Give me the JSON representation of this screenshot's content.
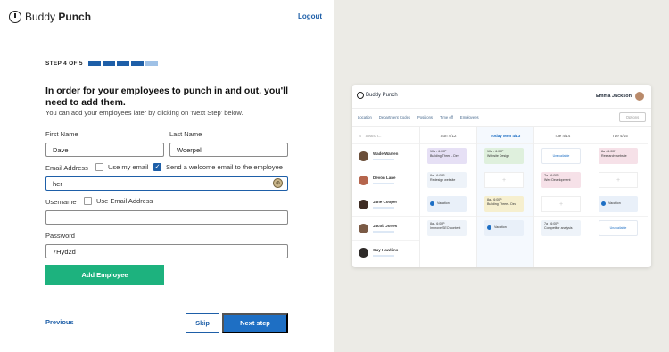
{
  "brand": {
    "name_light": "Buddy",
    "name_bold": "Punch"
  },
  "header": {
    "logout": "Logout"
  },
  "step": {
    "label": "STEP 4 OF 5",
    "current": 4,
    "total": 5
  },
  "intro": {
    "heading": "In order for your employees to punch in and out, you'll need to add them.",
    "subtext": "You can add your employees later by clicking on 'Next Step' below."
  },
  "form": {
    "first_name_label": "First Name",
    "first_name_value": "Dave",
    "last_name_label": "Last Name",
    "last_name_value": "Woerpel",
    "email_label": "Email Address",
    "use_my_email_label": "Use my email",
    "welcome_email_label": "Send a welcome email to the employee",
    "email_value": "her",
    "username_label": "Username",
    "use_email_address_label": "Use Email Address",
    "username_value": "",
    "password_label": "Password",
    "password_value": "7Hyd2d",
    "add_employee_button": "Add Employee"
  },
  "footer": {
    "previous": "Previous",
    "skip": "Skip",
    "next_step": "Next step"
  },
  "preview": {
    "brand": "Buddy Punch",
    "user_name": "Emma Jackson",
    "filters": [
      "Location",
      "Department Codes",
      "Positions",
      "Time off",
      "Employees"
    ],
    "options": "Options",
    "search": "Search...",
    "employees": [
      {
        "name": "Wade Warren",
        "avatar_color": "#6b4f3a"
      },
      {
        "name": "Devon Lane",
        "avatar_color": "#b5654c"
      },
      {
        "name": "Jane Cooper",
        "avatar_color": "#3e2c23"
      },
      {
        "name": "Jacob Jones",
        "avatar_color": "#7a5a45"
      },
      {
        "name": "Guy Hawkins",
        "avatar_color": "#2e2a28"
      }
    ],
    "days": [
      "Sun 4/12",
      "Today Mon 4/13",
      "Tue 4/14",
      "Tue 4/15"
    ],
    "cells": {
      "c0r0": {
        "line1": "10a - 6:00P",
        "line2": "Building Three - Dev"
      },
      "c1r0": {
        "line1": "10a - 6:00P",
        "line2": "Website Design"
      },
      "c2r0": {
        "line1": "Unavailable"
      },
      "c3r0": {
        "line1": "8a - 6:00P",
        "line2": "Research website"
      },
      "c0r1": {
        "line1": "8a - 6:00P",
        "line2": "Redesign website"
      },
      "c2r1": {
        "line1": "7a - 6:00P",
        "line2": "Web Development"
      },
      "c0r2": {
        "line1": "Vacation"
      },
      "c1r2": {
        "line1": "8a - 6:00P",
        "line2": "Building Three - Dev"
      },
      "c3r2": {
        "line1": "Vacation"
      },
      "c0r3": {
        "line1": "8a - 6:00P",
        "line2": "Improve SEO content"
      },
      "c1r3": {
        "line1": "Vacation"
      },
      "c2r3": {
        "line1": "7a - 6:00P",
        "line2": "Competitor analysis"
      },
      "c3r3": {
        "line1": "Unavailable"
      }
    }
  }
}
